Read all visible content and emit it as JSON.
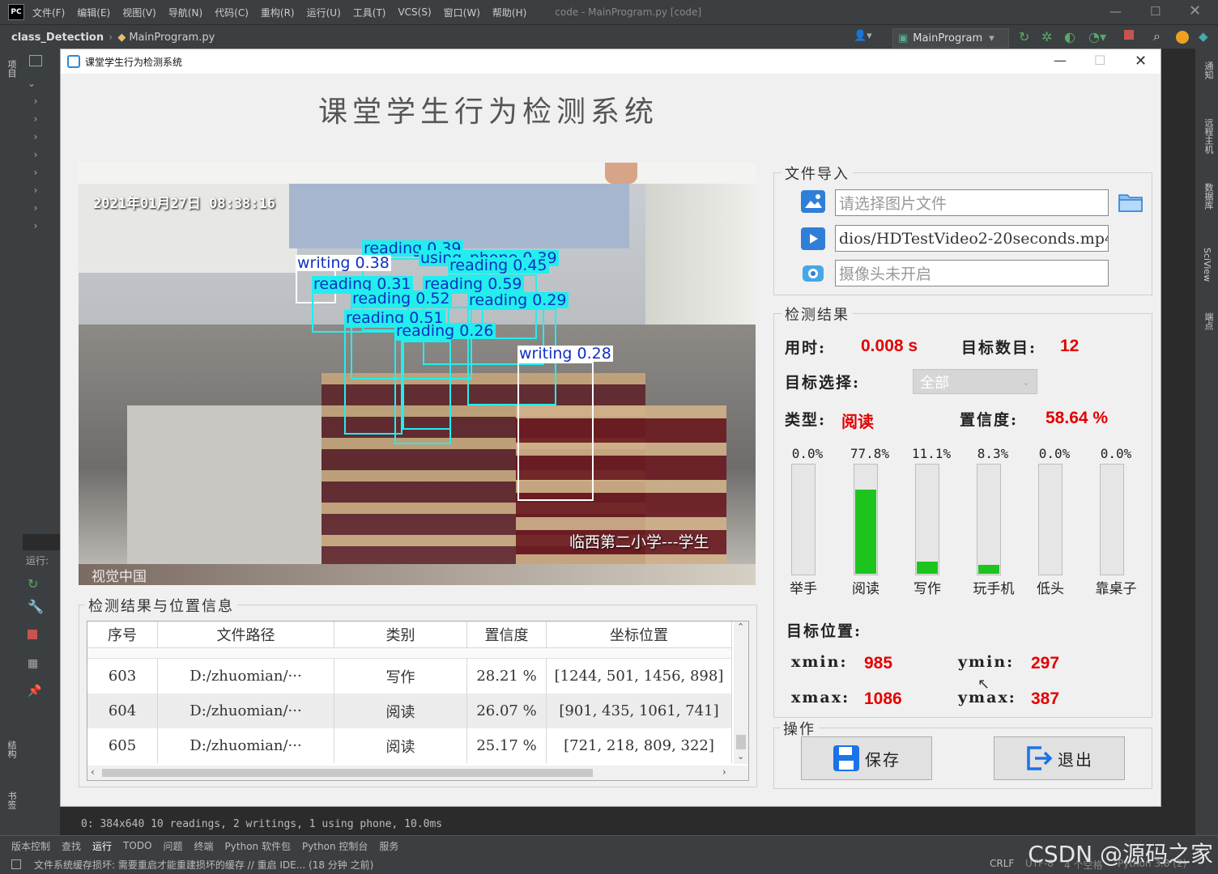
{
  "ide": {
    "menu": [
      "文件(F)",
      "编辑(E)",
      "视图(V)",
      "导航(N)",
      "代码(C)",
      "重构(R)",
      "运行(U)",
      "工具(T)",
      "VCS(S)",
      "窗口(W)",
      "帮助(H)"
    ],
    "window_title": "code - MainProgram.py [code]",
    "breadcrumb_project": "class_Detection",
    "breadcrumb_file": "MainProgram.py",
    "run_config": "MainProgram",
    "run_label": "运行:",
    "console_line": "0: 384x640 10 readings, 2 writings, 1 using phone, 10.0ms",
    "status_tabs": [
      "版本控制",
      "查找",
      "运行",
      "TODO",
      "问题",
      "终端",
      "Python 软件包",
      "Python 控制台",
      "服务"
    ],
    "status_message": "文件系统缓存损坏: 需要重启才能重建损坏的缓存 // 重启 IDE... (18 分钟 之前)",
    "status_right": [
      "CRLF",
      "UTF-8",
      "4 个空格",
      "Python 3.8 (2)"
    ],
    "right_tools": [
      "通知",
      "远程主机",
      "数据库",
      "SciView",
      "端点"
    ],
    "left_tools": [
      "项目",
      "结构",
      "书签"
    ],
    "watermark": "CSDN @源码之家"
  },
  "app": {
    "window_title": "课堂学生行为检测系统",
    "heading": "课堂学生行为检测系统",
    "video": {
      "timestamp": "2021年01月27日 08:38:16",
      "caption": "临西第二小学---学生",
      "logo": "视觉中国",
      "detections": [
        {
          "label": "reading 0.39"
        },
        {
          "label": "writing 0.38"
        },
        {
          "label": "using_phone 0.39"
        },
        {
          "label": "reading 0.45"
        },
        {
          "label": "reading 0.31"
        },
        {
          "label": "reading 0.59"
        },
        {
          "label": "reading 0.52"
        },
        {
          "label": "reading 0.29"
        },
        {
          "label": "reading 0.51"
        },
        {
          "label": "reading 0.26"
        },
        {
          "label": "writing 0.28"
        }
      ]
    },
    "file_import": {
      "title": "文件导入",
      "image_placeholder": "请选择图片文件",
      "video_value": "dios/HDTestVideo2-20seconds.mp4",
      "camera_placeholder": "摄像头未开启"
    },
    "results": {
      "title": "检测结果",
      "time_label": "用时:",
      "time_value": "0.008 s",
      "count_label": "目标数目:",
      "count_value": "12",
      "select_label": "目标选择:",
      "select_value": "全部",
      "type_label": "类型:",
      "type_value": "阅读",
      "conf_label": "置信度:",
      "conf_value": "58.64 %",
      "bars": [
        {
          "label": "举手",
          "pct_text": "0.0%",
          "value": 0.0
        },
        {
          "label": "阅读",
          "pct_text": "77.8%",
          "value": 77.8
        },
        {
          "label": "写作",
          "pct_text": "11.1%",
          "value": 11.1
        },
        {
          "label": "玩手机",
          "pct_text": "8.3%",
          "value": 8.3
        },
        {
          "label": "低头",
          "pct_text": "0.0%",
          "value": 0.0
        },
        {
          "label": "靠桌子",
          "pct_text": "0.0%",
          "value": 0.0
        }
      ],
      "pos_label": "目标位置:",
      "xmin_label": "xmin:",
      "xmin_value": "985",
      "ymin_label": "ymin:",
      "ymin_value": "297",
      "xmax_label": "xmax:",
      "xmax_value": "1086",
      "ymax_label": "ymax:",
      "ymax_value": "387"
    },
    "operations": {
      "title": "操作",
      "save": "保存",
      "exit": "退出"
    },
    "table": {
      "title": "检测结果与位置信息",
      "headers": [
        "序号",
        "文件路径",
        "类别",
        "置信度",
        "坐标位置"
      ],
      "rows": [
        {
          "id": "603",
          "path": "D:/zhuomian/···",
          "cls": "写作",
          "conf": "28.21 %",
          "pos": "[1244, 501, 1456, 898]"
        },
        {
          "id": "604",
          "path": "D:/zhuomian/···",
          "cls": "阅读",
          "conf": "26.07 %",
          "pos": "[901, 435, 1061, 741]"
        },
        {
          "id": "605",
          "path": "D:/zhuomian/···",
          "cls": "阅读",
          "conf": "25.17 %",
          "pos": "[721, 218, 809, 322]"
        }
      ]
    }
  }
}
